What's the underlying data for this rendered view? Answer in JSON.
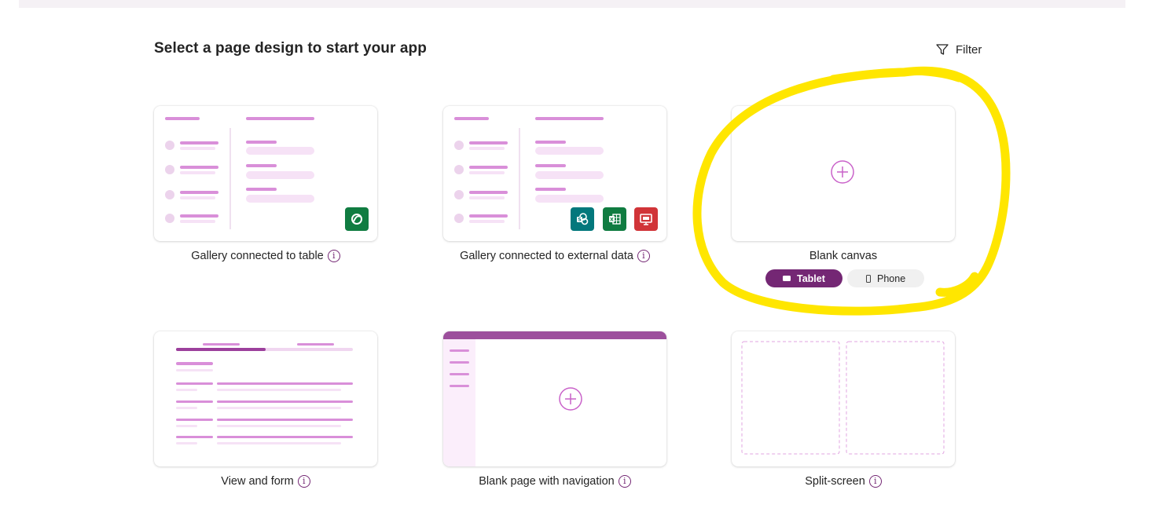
{
  "page": {
    "heading": "Select a page design to start your app",
    "filter_label": "Filter"
  },
  "cards": [
    {
      "label": "Gallery connected to table",
      "badges": [
        "dataverse-icon"
      ]
    },
    {
      "label": "Gallery connected to external data",
      "badges": [
        "sharepoint-icon",
        "excel-icon",
        "sql-icon"
      ]
    },
    {
      "label": "Blank canvas",
      "options": [
        "Tablet",
        "Phone"
      ],
      "selected_option": "Tablet"
    },
    {
      "label": "View and form"
    },
    {
      "label": "Blank page with navigation"
    },
    {
      "label": "Split-screen"
    }
  ],
  "colors": {
    "accent": "#742774",
    "pink_line": "#d98fd9",
    "pink_light": "#f6e2f6",
    "dataverse_green": "#107c41",
    "sharepoint_teal": "#03787c",
    "sql_red": "#d13438",
    "annotation_yellow": "#ffe600"
  }
}
